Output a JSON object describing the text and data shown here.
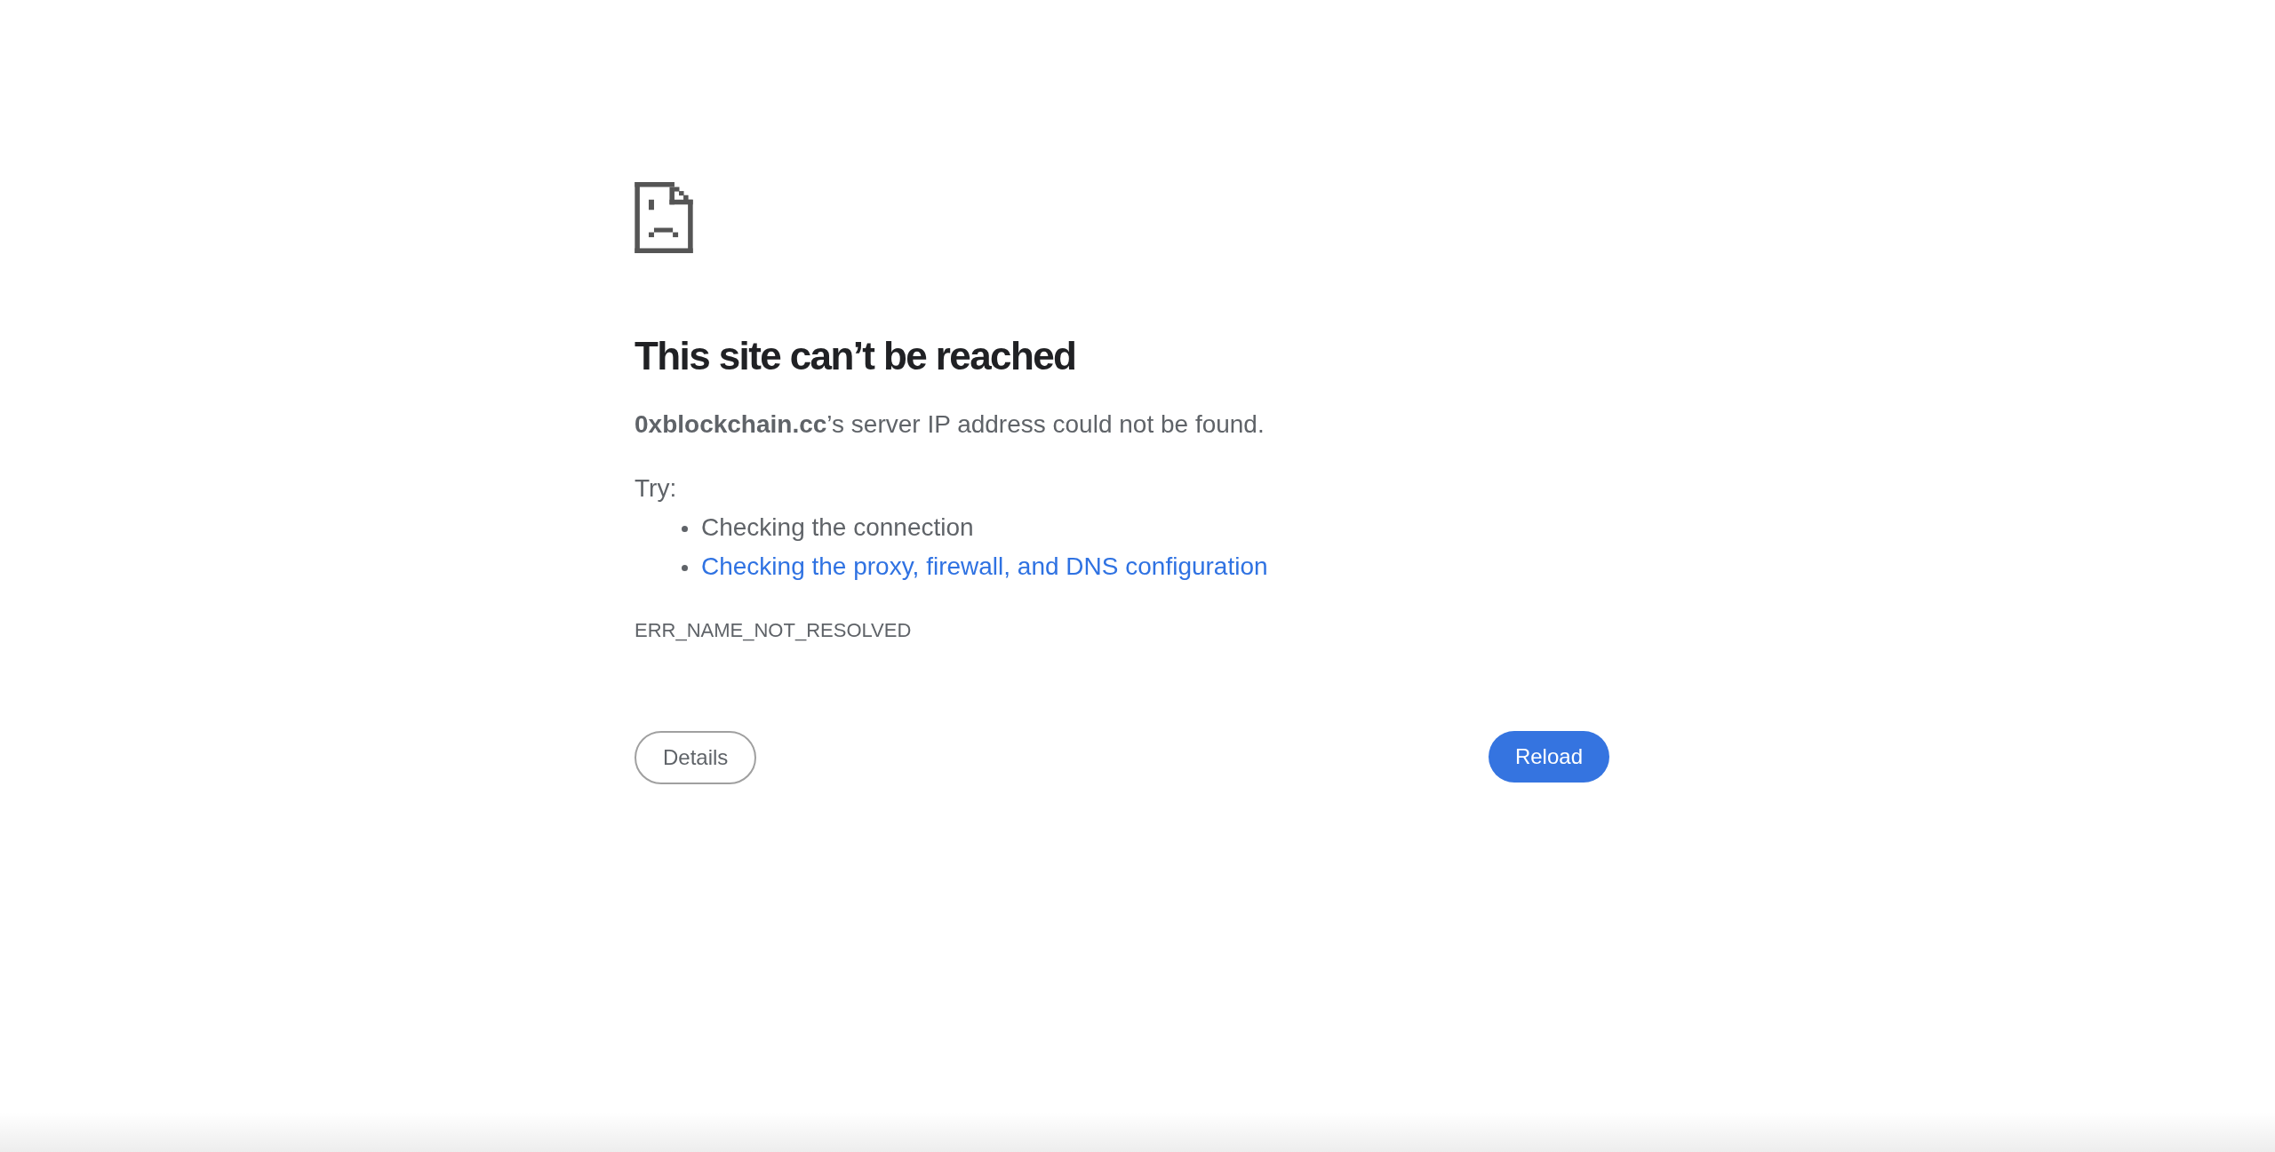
{
  "error": {
    "title": "This site can’t be reached",
    "summary": "**0xblockchain.cc**’s server IP address could not be found.",
    "suggestions_heading": "Try:",
    "suggestions": [
      {
        "kind": "text",
        "text": "Checking the connection"
      },
      {
        "kind": "link",
        "text": "Checking the proxy, firewall, and DNS configuration"
      }
    ],
    "error_code": "ERR_NAME_NOT_RESOLVED"
  },
  "buttons": [
    {
      "kind": "secondary",
      "label": "Details"
    },
    {
      "kind": "primary",
      "label": "Reload"
    }
  ]
}
